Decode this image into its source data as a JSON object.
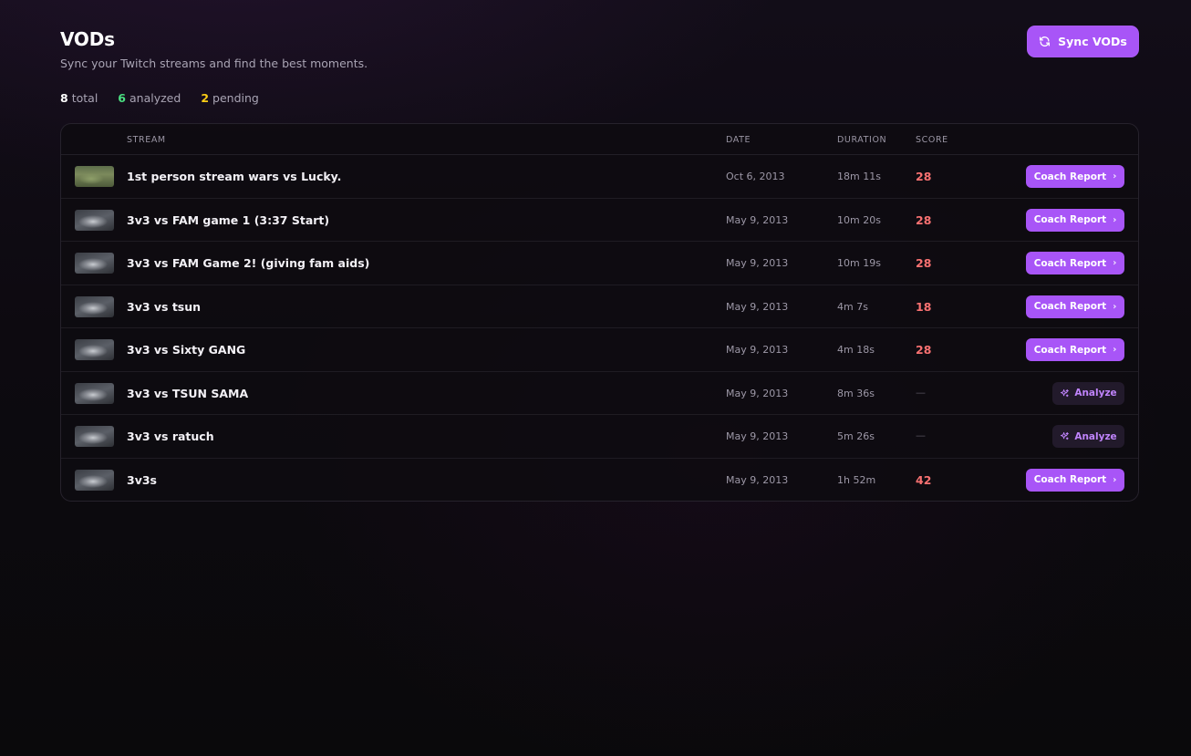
{
  "header": {
    "title": "VODs",
    "subtitle": "Sync your Twitch streams and find the best moments.",
    "sync_label": "Sync VODs",
    "sync_icon": "refresh-icon"
  },
  "stats": {
    "total_count": "8",
    "total_label": "total",
    "analyzed_count": "6",
    "analyzed_label": "analyzed",
    "pending_count": "2",
    "pending_label": "pending"
  },
  "colors": {
    "accent": "#a855f7",
    "score": "#f87171",
    "analyzed": "#4ade80",
    "pending": "#facc15"
  },
  "table": {
    "columns": {
      "stream": "STREAM",
      "date": "DATE",
      "duration": "DURATION",
      "score": "SCORE"
    },
    "rows": [
      {
        "name": "1st person stream wars vs Lucky.",
        "date": "Oct 6, 2013",
        "duration": "18m 11s",
        "score": "28",
        "action": "Coach Report",
        "thumb": "green"
      },
      {
        "name": "3v3 vs FAM game 1 (3:37 Start)",
        "date": "May 9, 2013",
        "duration": "10m 20s",
        "score": "28",
        "action": "Coach Report",
        "thumb": "gray"
      },
      {
        "name": "3v3 vs FAM Game 2! (giving fam aids)",
        "date": "May 9, 2013",
        "duration": "10m 19s",
        "score": "28",
        "action": "Coach Report",
        "thumb": "gray"
      },
      {
        "name": "3v3 vs tsun",
        "date": "May 9, 2013",
        "duration": "4m 7s",
        "score": "18",
        "action": "Coach Report",
        "thumb": "gray"
      },
      {
        "name": "3v3 vs Sixty GANG",
        "date": "May 9, 2013",
        "duration": "4m 18s",
        "score": "28",
        "action": "Coach Report",
        "thumb": "gray"
      },
      {
        "name": "3v3 vs TSUN SAMA",
        "date": "May 9, 2013",
        "duration": "8m 36s",
        "score": "—",
        "action": "Analyze",
        "thumb": "gray"
      },
      {
        "name": "3v3 vs ratuch",
        "date": "May 9, 2013",
        "duration": "5m 26s",
        "score": "—",
        "action": "Analyze",
        "thumb": "gray"
      },
      {
        "name": "3v3s",
        "date": "May 9, 2013",
        "duration": "1h 52m",
        "score": "42",
        "action": "Coach Report",
        "thumb": "gray"
      }
    ]
  }
}
